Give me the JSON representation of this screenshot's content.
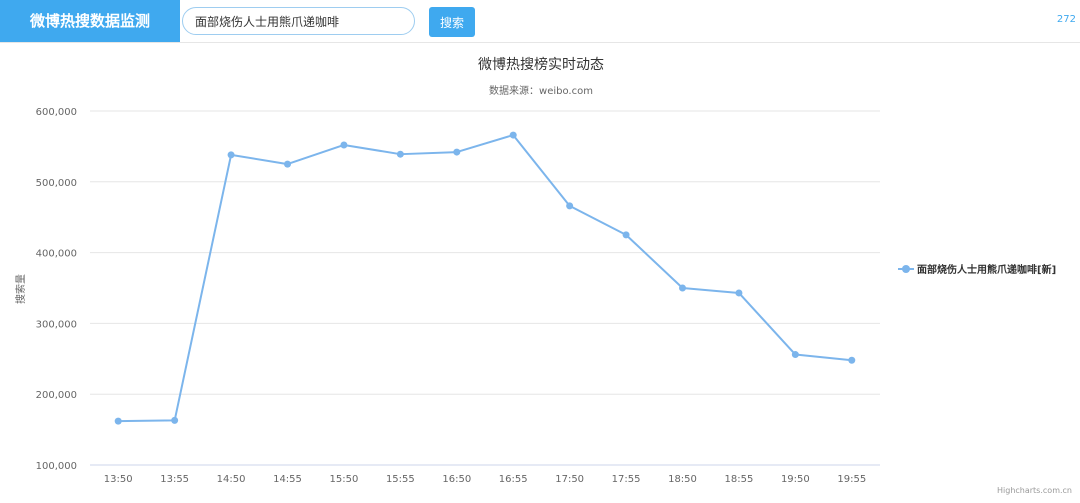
{
  "header": {
    "brand_title": "微博热搜数据监测",
    "search_value": "面部烧伤人士用熊爪递咖啡",
    "search_button_label": "搜索",
    "counter_text": "272"
  },
  "credit": "Highcharts.com.cn",
  "colors": {
    "accent": "#3fa9ef",
    "series": "#7cb5ec",
    "grid": "#e6e6e6",
    "axis_text": "#666666",
    "title_text": "#333333"
  },
  "chart_data": {
    "type": "line",
    "title": "微博热搜榜实时动态",
    "subtitle": "数据来源：weibo.com",
    "xlabel": "",
    "ylabel": "搜索量",
    "categories": [
      "13:50",
      "13:55",
      "14:50",
      "14:55",
      "15:50",
      "15:55",
      "16:50",
      "16:55",
      "17:50",
      "17:55",
      "18:50",
      "18:55",
      "19:50",
      "19:55"
    ],
    "y_ticks": [
      "100,000",
      "200,000",
      "300,000",
      "400,000",
      "500,000",
      "600,000"
    ],
    "ylim": [
      100000,
      600000
    ],
    "grid": true,
    "legend_position": "right",
    "series": [
      {
        "name": "面部烧伤人士用熊爪递咖啡[新]",
        "values": [
          162000,
          163000,
          538000,
          525000,
          552000,
          539000,
          542000,
          566000,
          466000,
          425000,
          350000,
          343000,
          256000,
          248000
        ]
      }
    ]
  }
}
